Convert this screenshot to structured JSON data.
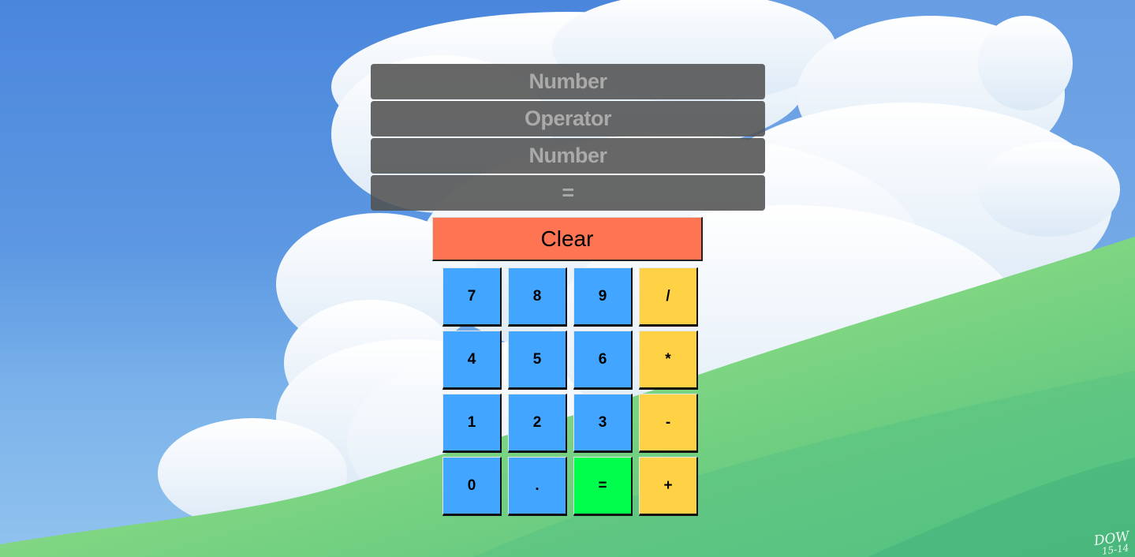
{
  "display": {
    "first_number": "Number",
    "operator": "Operator",
    "second_number": "Number",
    "result": "="
  },
  "clear_label": "Clear",
  "keypad": {
    "row1": [
      "7",
      "8",
      "9",
      "/"
    ],
    "row2": [
      "4",
      "5",
      "6",
      "*"
    ],
    "row3": [
      "1",
      "2",
      "3",
      "-"
    ],
    "row4": [
      "0",
      ".",
      "=",
      "+"
    ]
  },
  "signature": {
    "name": "DOW",
    "date": "15-14"
  },
  "colors": {
    "number_key": "#42a5ff",
    "operator_key": "#ffd246",
    "equals_key": "#00ff4c",
    "clear_button": "#ff7452",
    "display_background": "#505050"
  }
}
